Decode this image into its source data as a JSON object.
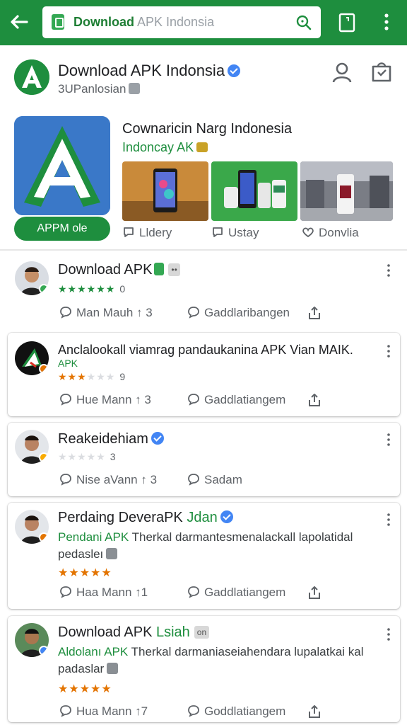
{
  "colors": {
    "brand": "#1e8e3e",
    "verified": "#4285f4",
    "star_green": "#1e8e3e",
    "star_orange": "#e37400"
  },
  "search": {
    "strong": "Download",
    "rest": " APK Indonsia"
  },
  "app": {
    "title": "Download APK Indonsia",
    "subtitle": "3UPanlosian"
  },
  "feature": {
    "install_label": "APPM ole",
    "title": "Cownaricin Narg Indonesia",
    "subtitle": "Indoncay AK",
    "actions": [
      "Lldery",
      "Ustay",
      "Donvlia"
    ]
  },
  "posts": [
    {
      "name": "Download APK",
      "tag": "••",
      "stars": "★★★★★★",
      "rating_count": "0",
      "actions": [
        "Man Mauh ↑ 3",
        "Gaddlaribangen"
      ]
    },
    {
      "line1": "Anclalookall viamrag pandaukanina APK Vian MAIK.",
      "line2": "APK",
      "stars_filled": "★★★",
      "stars_empty": "★★★",
      "rating_count": "9",
      "actions": [
        "Hue Mann ↑ 3",
        "Gaddlatiangem"
      ]
    },
    {
      "name": "Reakeidehiam",
      "stars_empty": "★★★★★",
      "rating_count": "3",
      "actions": [
        "Nise aVann ↑ 3",
        "Sadam"
      ]
    },
    {
      "name_a": "Perdaing DeveraPK ",
      "name_b": "Jdan",
      "line_green": "Pendani APK",
      "line_rest": " Therkal darmantesmenalackall lapolatidal",
      "line2": "pedasleı",
      "stars": "★★★★★",
      "actions": [
        "Haa Mann ↑1",
        "Gaddlatiangem"
      ]
    },
    {
      "name_a": "Download APK ",
      "name_b": "Lsiah",
      "tag": "on",
      "line_green": "Aldolanı APK",
      "line_rest": " Therkal darmaniaseiahendara lupalatkai kal",
      "line2": "padaslar",
      "stars": "★★★★★",
      "actions": [
        "Hua Mann ↑7",
        "Goddlatiangem"
      ]
    }
  ]
}
